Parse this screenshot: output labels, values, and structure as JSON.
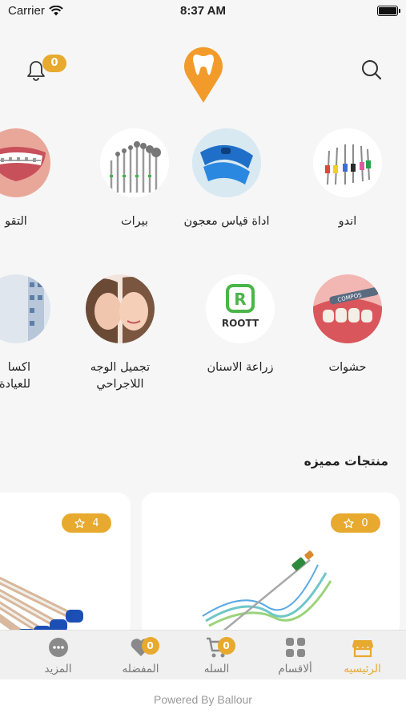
{
  "status_bar": {
    "carrier": "Carrier",
    "time": "8:37 AM"
  },
  "header": {
    "notification_count": "0"
  },
  "categories_row1": [
    {
      "label": "اندو",
      "icon": "endo-files-image"
    },
    {
      "label": "اداة قياس معجون",
      "icon": "impression-tray-image"
    },
    {
      "label": "بيرات",
      "icon": "dental-burs-image"
    },
    {
      "label": "التقو",
      "icon": "braces-image"
    }
  ],
  "categories_row2": [
    {
      "label": "حشوات",
      "icon": "fillings-image"
    },
    {
      "label": "زراعة الاسنان",
      "icon": "roott-logo-image",
      "logo_text": "ROOTT"
    },
    {
      "label": "تجميل الوجه اللاجراحي",
      "label_line1": "تجميل الوجه",
      "label_line2": "اللاجراحي",
      "icon": "face-beauty-image"
    },
    {
      "label_line1": "اكسا",
      "label_line2": "للعيادة",
      "icon": "clinic-supplies-image"
    }
  ],
  "featured": {
    "title": "منتجات مميزه",
    "products": [
      {
        "rating": "0",
        "image": "endo-file-image"
      },
      {
        "rating": "4",
        "image": "blue-tips-image"
      }
    ]
  },
  "tabbar": {
    "tabs": [
      {
        "label": "الرئيسيه",
        "icon": "store-icon",
        "active": true
      },
      {
        "label": "ألاقسام",
        "icon": "grid-icon"
      },
      {
        "label": "السله",
        "icon": "cart-icon",
        "badge": "0"
      },
      {
        "label": "المفضله",
        "icon": "heart-icon",
        "badge": "0"
      },
      {
        "label": "المزيد",
        "icon": "more-icon"
      }
    ]
  },
  "footer": {
    "text": "Powered By Ballour"
  },
  "colors": {
    "accent": "#e7a92e",
    "background": "#f6f6f6"
  }
}
